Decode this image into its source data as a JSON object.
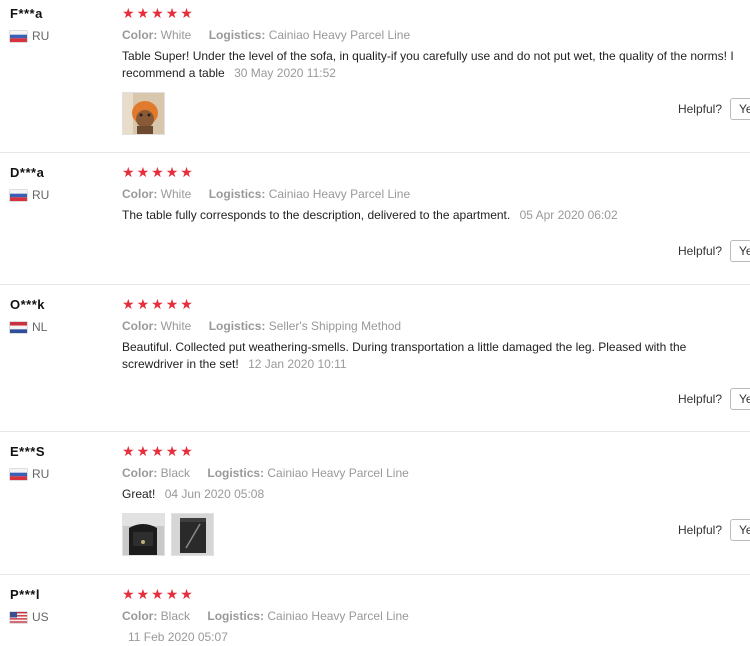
{
  "helpful_label": "Helpful?",
  "yes_label": "Ye",
  "star_char": "★",
  "star_color": "#e62e3c",
  "attr_labels": {
    "color": "Color:",
    "logistics": "Logistics:"
  },
  "reviews": [
    {
      "user": "F***a",
      "country": "RU",
      "rating": 5,
      "color": "White",
      "logistics": "Cainiao Heavy Parcel Line",
      "text_line1": "Table Super! Under the level of the sofa, in quality-if you carefully use and do not put wet, the quality of the norms! I",
      "text_line2": "recommend a table",
      "date": "30 May 2020 11:52",
      "photo_count": 1
    },
    {
      "user": "D***a",
      "country": "RU",
      "rating": 5,
      "color": "White",
      "logistics": "Cainiao Heavy Parcel Line",
      "text_line1": "The table fully corresponds to the description, delivered to the apartment.",
      "date": "05 Apr 2020 06:02",
      "photo_count": 0
    },
    {
      "user": "O***k",
      "country": "NL",
      "rating": 5,
      "color": "White",
      "logistics": "Seller's Shipping Method",
      "text_line1": "Beautiful. Collected put weathering-smells. During transportation a little damaged the leg. Pleased with the",
      "text_line2": "screwdriver in the set!",
      "date": "12 Jan 2020 10:11",
      "photo_count": 0
    },
    {
      "user": "E***S",
      "country": "RU",
      "rating": 5,
      "color": "Black",
      "logistics": "Cainiao Heavy Parcel Line",
      "text_line1": "Great!",
      "date": "04 Jun 2020 05:08",
      "photo_count": 2
    },
    {
      "user": "P***l",
      "country": "US",
      "rating": 5,
      "color": "Black",
      "logistics": "Cainiao Heavy Parcel Line",
      "text_line1": "",
      "date": "11 Feb 2020 05:07",
      "photo_count": 0
    }
  ]
}
